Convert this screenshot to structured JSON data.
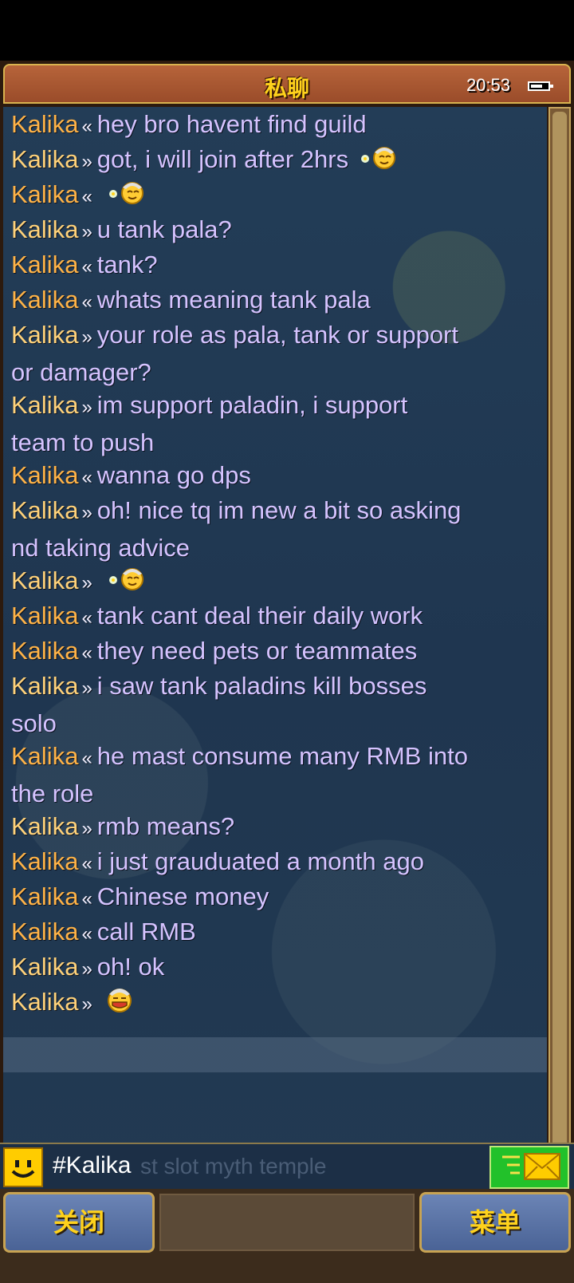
{
  "header": {
    "title": "私聊",
    "time": "20:53"
  },
  "messages": [
    {
      "name": "Kalika",
      "direction": "«",
      "text": "hey bro havent find guild"
    },
    {
      "name": "Kalika",
      "direction": "»",
      "text": "got, i will join after 2hrs",
      "emote": "smiley-helmet-icon"
    },
    {
      "name": "Kalika",
      "direction": "«",
      "text": "",
      "emote": "smiley-helmet-icon"
    },
    {
      "name": "Kalika",
      "direction": "»",
      "text": "u tank pala?"
    },
    {
      "name": "Kalika",
      "direction": "«",
      "text": "tank?"
    },
    {
      "name": "Kalika",
      "direction": "«",
      "text": "whats meaning tank pala"
    },
    {
      "name": "Kalika",
      "direction": "»",
      "text": "your role as pala, tank or support",
      "text_cont": "or damager?"
    },
    {
      "name": "Kalika",
      "direction": "»",
      "text": "im support paladin, i support",
      "text_cont": "team to push"
    },
    {
      "name": "Kalika",
      "direction": "«",
      "text": "wanna go dps"
    },
    {
      "name": "Kalika",
      "direction": "»",
      "text": "oh! nice tq im new a bit so asking",
      "text_cont": "nd taking advice"
    },
    {
      "name": "Kalika",
      "direction": "»",
      "text": "",
      "emote": "smiley-helmet-icon"
    },
    {
      "name": "Kalika",
      "direction": "«",
      "text": "tank cant deal their daily work"
    },
    {
      "name": "Kalika",
      "direction": "«",
      "text": "they need pets or teammates"
    },
    {
      "name": "Kalika",
      "direction": "»",
      "text": "i saw tank paladins kill bosses",
      "text_cont": "solo"
    },
    {
      "name": "Kalika",
      "direction": "«",
      "text": "he mast consume many RMB into",
      "text_cont": "the role"
    },
    {
      "name": "Kalika",
      "direction": "»",
      "text": "rmb means?"
    },
    {
      "name": "Kalika",
      "direction": "«",
      "text": "i just grauduated a month ago"
    },
    {
      "name": "Kalika",
      "direction": "«",
      "text": "Chinese money"
    },
    {
      "name": "Kalika",
      "direction": "«",
      "text": "call RMB"
    },
    {
      "name": "Kalika",
      "direction": "»",
      "text": "oh! ok"
    },
    {
      "name": "Kalika",
      "direction": "»",
      "text": "",
      "emote": "laughing-helmet-icon"
    }
  ],
  "input": {
    "value": "#Kalika",
    "ghost": "st slot myth temple"
  },
  "buttons": {
    "close": "关闭",
    "menu": "菜单"
  },
  "colors": {
    "name": "#ffb347",
    "message": "#d5c3ff",
    "title": "#ffd21c"
  }
}
